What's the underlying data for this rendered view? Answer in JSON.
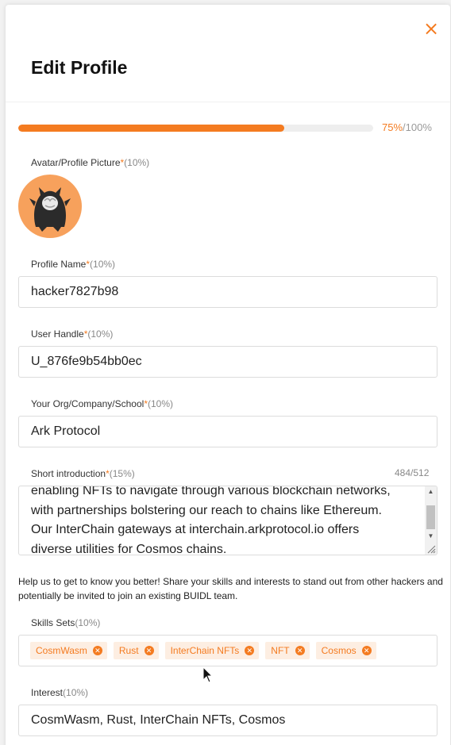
{
  "modal": {
    "close_icon": "×",
    "title": "Edit Profile"
  },
  "progress": {
    "current": "75%",
    "total": "/100%",
    "value": 0.75
  },
  "fields": {
    "avatar": {
      "label": "Avatar/Profile Picture",
      "required": "*",
      "pct": "(10%)"
    },
    "profile_name": {
      "label": "Profile Name",
      "required": "*",
      "pct": "(10%)",
      "value": "hacker7827b98"
    },
    "user_handle": {
      "label": "User Handle",
      "required": "*",
      "pct": "(10%)",
      "value": "U_876fe9b54bb0ec"
    },
    "org": {
      "label": "Your Org/Company/School",
      "required": "*",
      "pct": "(10%)",
      "value": "Ark Protocol"
    },
    "intro": {
      "label": "Short introduction",
      "required": "*",
      "pct": "(15%)",
      "counter": "484/512",
      "lines": [
        "enabling NFTs to navigate through various blockchain networks,",
        "with partnerships bolstering our reach to chains like Ethereum.",
        "Our InterChain gateways at interchain.arkprotocol.io offers",
        "diverse utilities for Cosmos chains."
      ]
    },
    "help_text": "Help us to get to know you better! Share your skills and interests to stand out from other hackers and potentially be invited to join an existing BUIDL team.",
    "skills": {
      "label": "Skills Sets",
      "pct": "(10%)",
      "tags": [
        "CosmWasm",
        "Rust",
        "InterChain NFTs",
        "NFT",
        "Cosmos"
      ]
    },
    "interest": {
      "label": "Interest",
      "pct": "(10%)",
      "value": "CosmWasm, Rust, InterChain NFTs, Cosmos"
    }
  },
  "colors": {
    "accent": "#f47b20",
    "accent_light": "#fdeee2",
    "avatar_bg": "#f7a15c"
  }
}
